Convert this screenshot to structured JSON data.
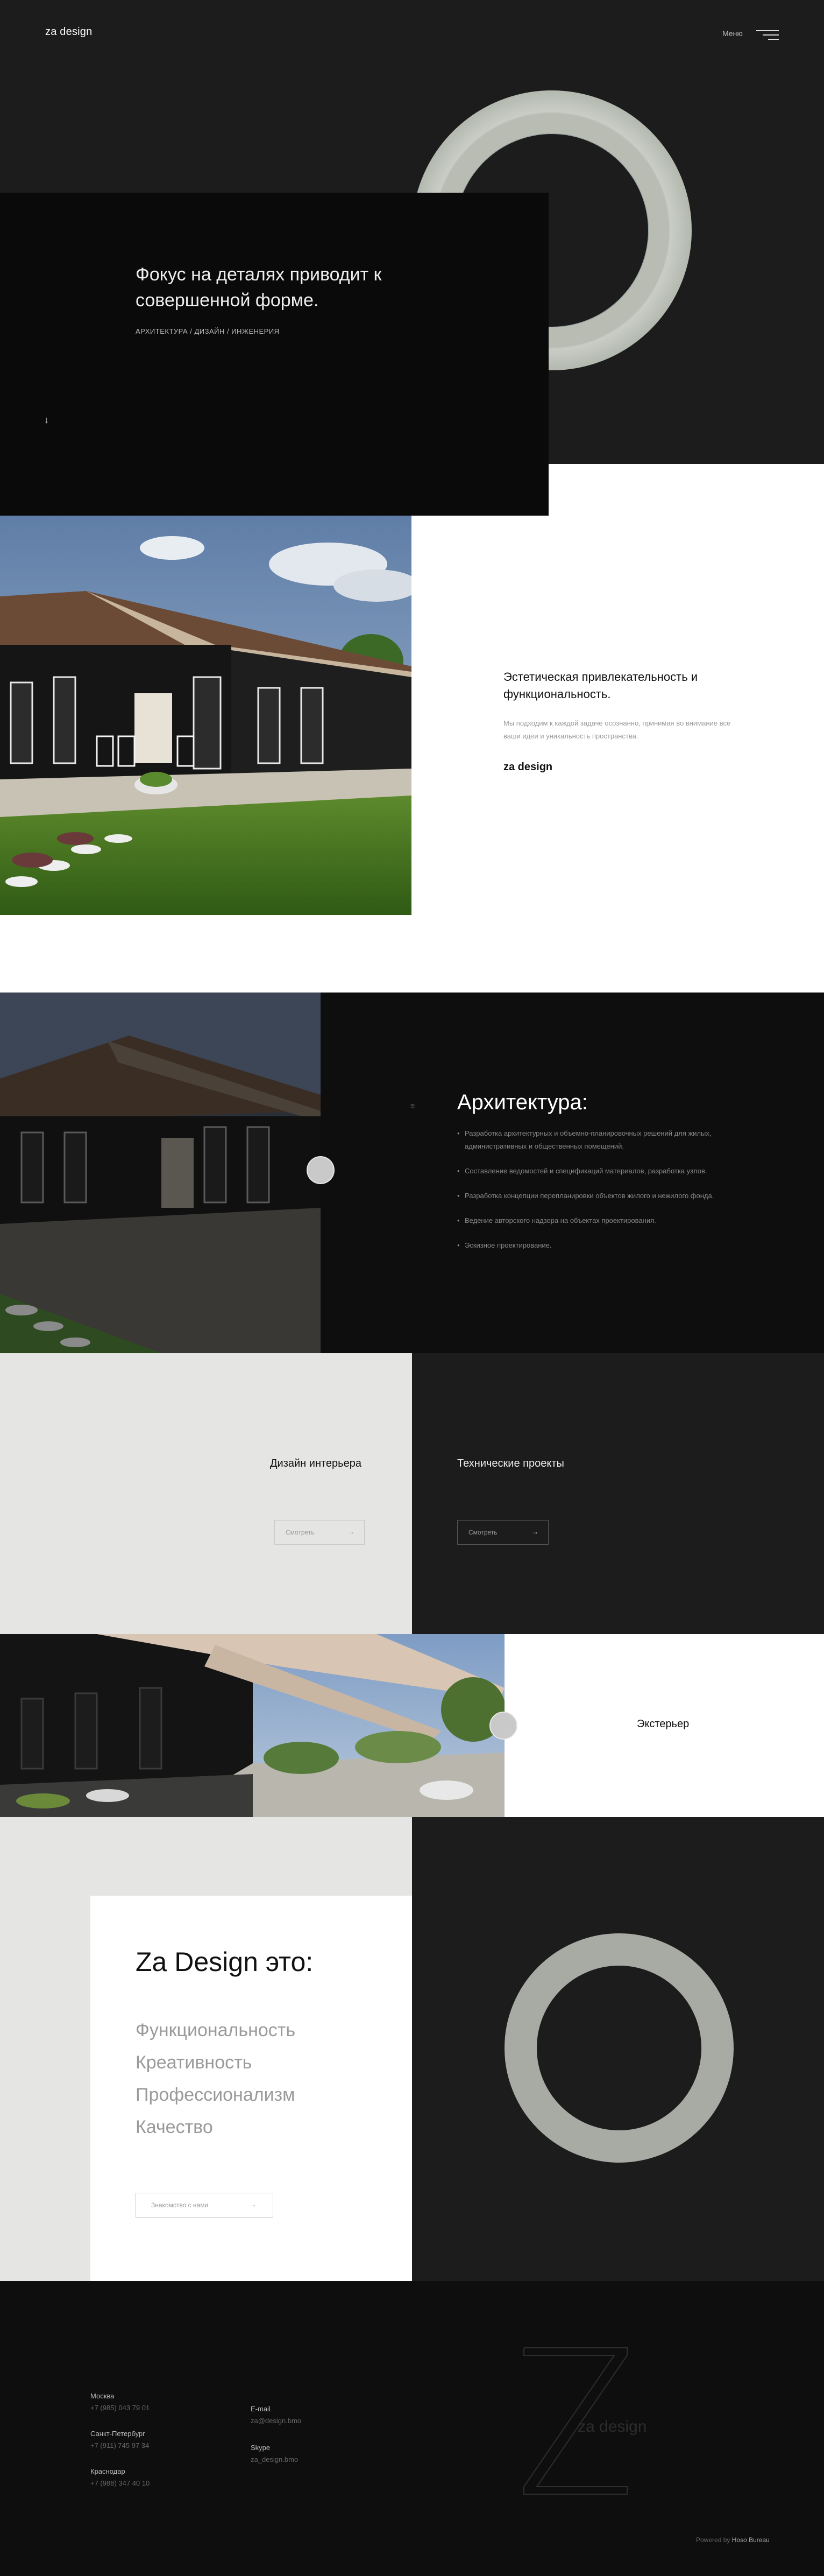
{
  "header": {
    "logo": "za design",
    "menu_label": "Меню"
  },
  "hero": {
    "title": "Фокус на деталях приводит к совершенной форме.",
    "subtitle": "АРХИТЕКТУРА / ДИЗАЙН / ИНЖЕНЕРИЯ",
    "scroll_arrow": "↓"
  },
  "about": {
    "title": "Эстетическая привлекательность и функциональность.",
    "description": "Мы подходим к каждой задаче осознанно, принимая во внимание все ваши идеи и уникальность пространства.",
    "logo": "za design"
  },
  "architecture": {
    "icon": "≡",
    "title": "Архитектура:",
    "items": [
      "Разработка архитектурных и объемно-планировочных решений для жилых, административных и общественных помещений.",
      "Составление ведомостей и спецификаций материалов, разработка узлов.",
      "Разработка концепции перепланировки объектов жилого и нежилого фонда.",
      "Ведение авторского надзора на объектах проектирования.",
      "Эскизное проектирование."
    ]
  },
  "services": {
    "interior": {
      "title": "Дизайн интерьера",
      "button": "Смотреть",
      "arrow": "→"
    },
    "technical": {
      "title": "Технические проекты",
      "button": "Смотреть",
      "arrow": "→"
    },
    "exterior": {
      "title": "Экстерьер"
    }
  },
  "za_design": {
    "title": "Za Design это:",
    "qualities": [
      "Функциональность",
      "Креативность",
      "Профессионализм",
      "Качество"
    ],
    "button": "Знакомство с нами",
    "arrow": "→"
  },
  "footer": {
    "contacts": [
      {
        "city": "Москва",
        "phone": "+7 (985) 043 79 01"
      },
      {
        "city": "Санкт-Петербург",
        "phone": "+7 (911) 745 97 34"
      },
      {
        "city": "Краснодар",
        "phone": "+7 (988) 347 40 10"
      }
    ],
    "email_label": "E-mail",
    "email": "za@design.bmo",
    "skype_label": "Skype",
    "skype": "za_design.bmo",
    "watermark": "za design",
    "powered_prefix": "Powered by",
    "powered_by": "Hoso Bureau"
  },
  "colors": {
    "dark": "#1c1c1c",
    "black": "#0a0a0a",
    "light_gray": "#e5e5e3",
    "ring": "#b8bcb2"
  }
}
